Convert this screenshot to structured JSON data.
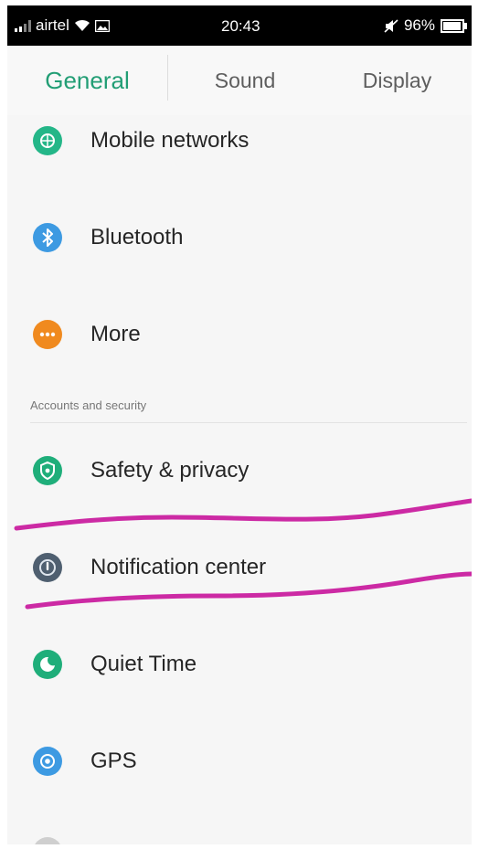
{
  "status_bar": {
    "carrier": "airtel",
    "time": "20:43",
    "battery": "96%"
  },
  "tabs": [
    {
      "label": "General",
      "active": true
    },
    {
      "label": "Sound",
      "active": false
    },
    {
      "label": "Display",
      "active": false
    }
  ],
  "sections": {
    "accounts_header": "Accounts and security"
  },
  "items": [
    {
      "label": "Mobile networks",
      "icon": "mobile-networks-icon",
      "color": "#24b688"
    },
    {
      "label": "Bluetooth",
      "icon": "bluetooth-icon",
      "color": "#3d9ae2"
    },
    {
      "label": "More",
      "icon": "more-icon",
      "color": "#f08a1f"
    },
    {
      "label": "Safety & privacy",
      "icon": "shield-icon",
      "color": "#1fae7a"
    },
    {
      "label": "Notification center",
      "icon": "notification-icon",
      "color": "#4f5f70"
    },
    {
      "label": "Quiet Time",
      "icon": "moon-icon",
      "color": "#1fae7a"
    },
    {
      "label": "GPS",
      "icon": "location-icon",
      "color": "#3d9ae2"
    }
  ],
  "colors": {
    "accent": "#229e75",
    "annotation": "#cc2aa4"
  }
}
